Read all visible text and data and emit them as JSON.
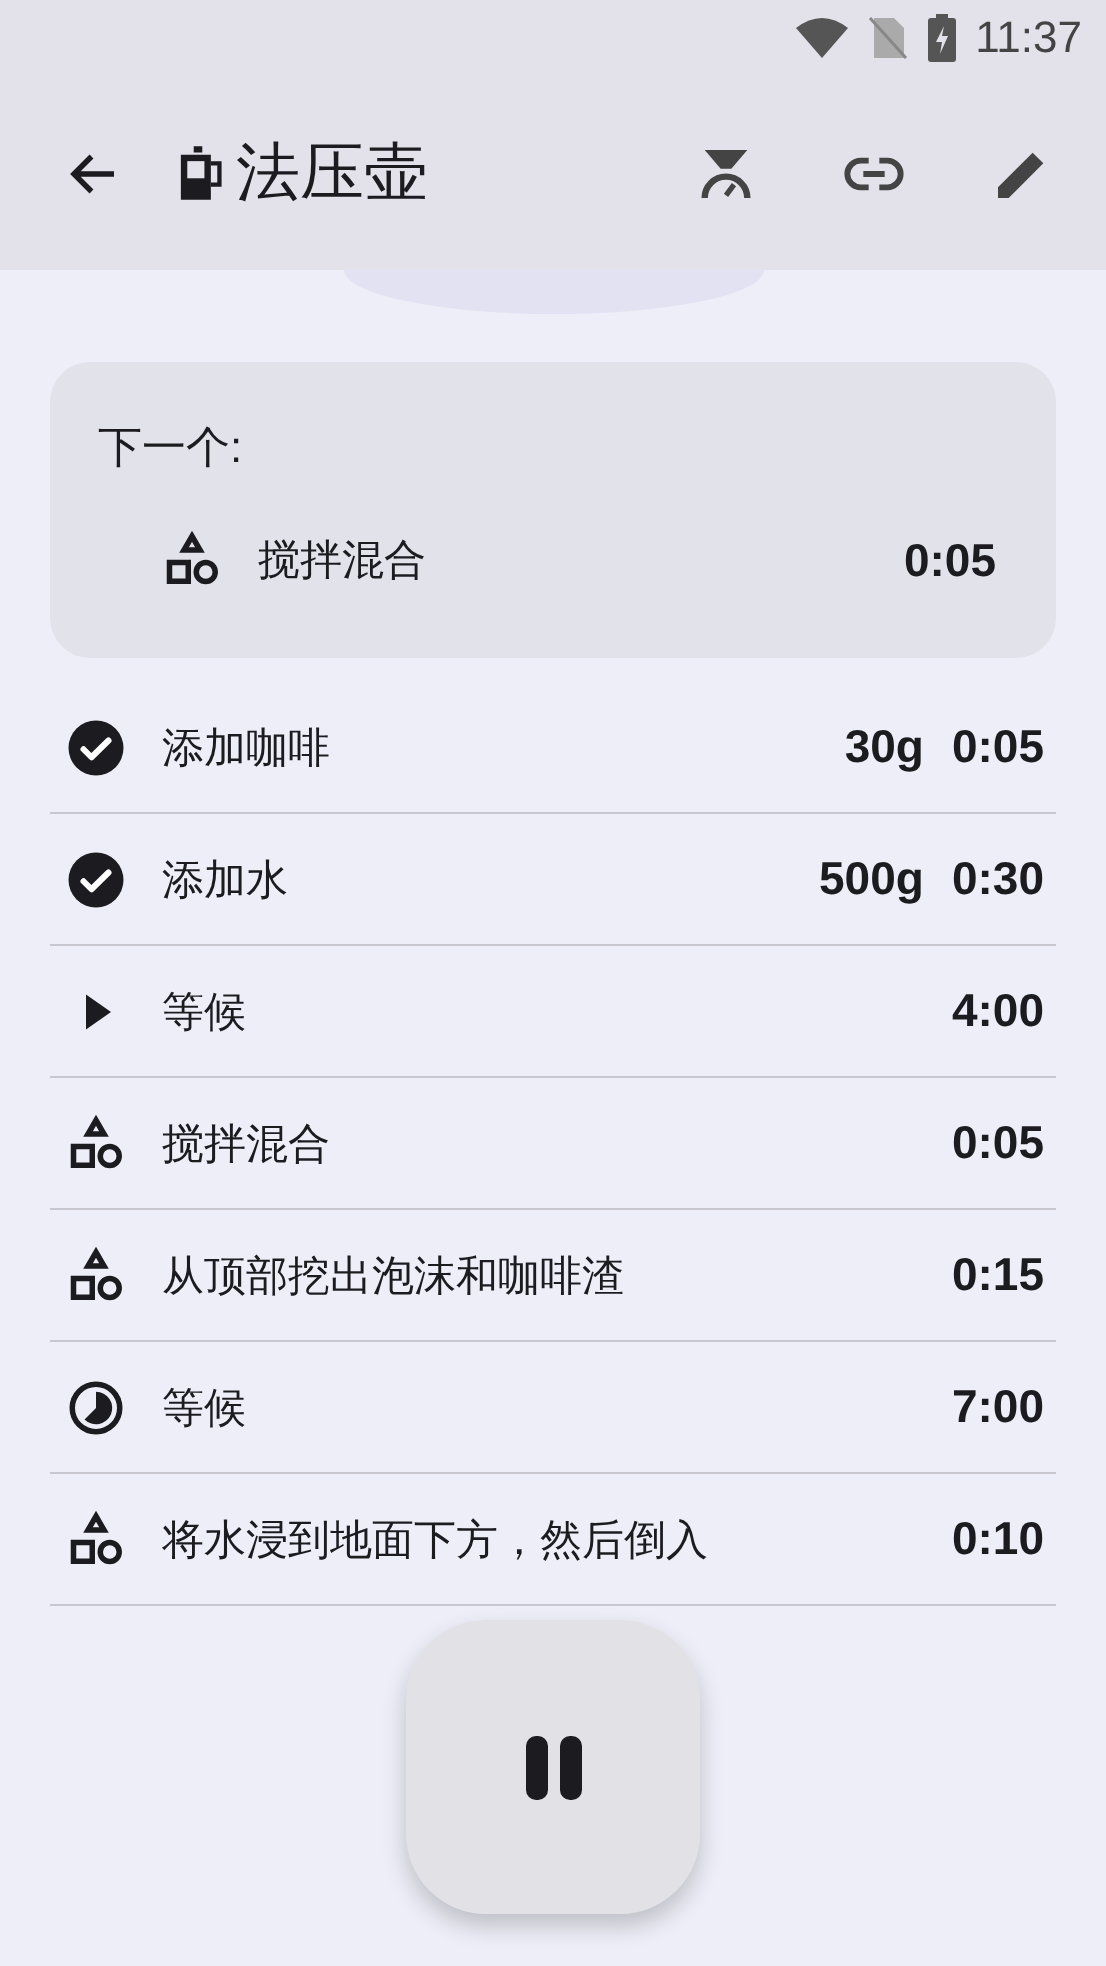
{
  "status_bar": {
    "time": "11:37"
  },
  "toolbar": {
    "title": "法压壶"
  },
  "next_card": {
    "heading": "下一个:",
    "step": {
      "kind": "shapes",
      "name": "搅拌混合",
      "time": "0:05"
    }
  },
  "steps": [
    {
      "kind": "done",
      "name": "添加咖啡",
      "amount": "30g",
      "time": "0:05"
    },
    {
      "kind": "done",
      "name": "添加水",
      "amount": "500g",
      "time": "0:30"
    },
    {
      "kind": "current",
      "name": "等候",
      "time": "4:00"
    },
    {
      "kind": "shapes",
      "name": "搅拌混合",
      "time": "0:05"
    },
    {
      "kind": "shapes",
      "name": "从顶部挖出泡沫和咖啡渣",
      "time": "0:15"
    },
    {
      "kind": "timer",
      "name": "等候",
      "time": "7:00"
    },
    {
      "kind": "shapes",
      "name": "将水浸到地面下方，然后倒入",
      "time": "0:10"
    }
  ]
}
